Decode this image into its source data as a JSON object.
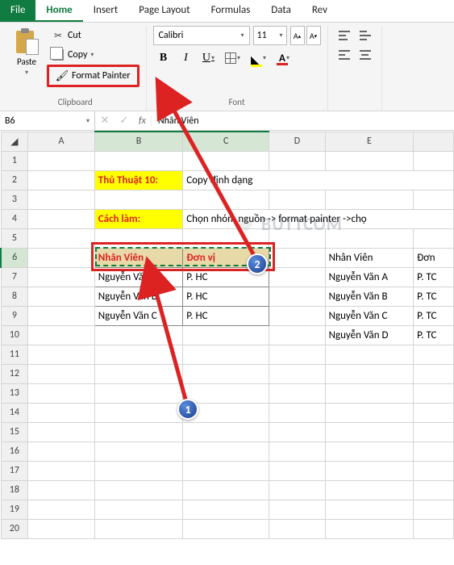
{
  "tabs": [
    "File",
    "Home",
    "Insert",
    "Page Layout",
    "Formulas",
    "Data",
    "Rev"
  ],
  "active_tab": 1,
  "clipboard": {
    "paste": "Paste",
    "cut": "Cut",
    "copy": "Copy",
    "format_painter": "Format Painter",
    "group_label": "Clipboard"
  },
  "font": {
    "name": "Calibri",
    "size": "11",
    "group_label": "Font"
  },
  "name_box": "B6",
  "formula_value": "Nhân Viên",
  "columns": [
    "A",
    "B",
    "C",
    "D",
    "E"
  ],
  "rows": [
    "1",
    "2",
    "3",
    "4",
    "5",
    "6",
    "7",
    "8",
    "9",
    "10",
    "11",
    "12",
    "13",
    "14",
    "15",
    "16",
    "17",
    "18",
    "19",
    "20"
  ],
  "cells": {
    "B2": "Thủ Thuật 10:",
    "C2": "Copy định dạng",
    "B4": "Cách làm:",
    "C4": "Chọn nhóm nguồn -> format painter ->chọ",
    "B6": "Nhân Viên",
    "C6": "Đơn vị",
    "B7": "Nguyễn Văn A",
    "C7": "P. HC",
    "B8": "Nguyễn Văn B",
    "C8": "P. HC",
    "B9": "Nguyễn Văn C",
    "C9": "P. HC",
    "E6": "Nhân Viên",
    "F6": "Đơn",
    "E7": "Nguyễn Văn A",
    "F7": "P. TC",
    "E8": "Nguyễn Văn B",
    "F8": "P. TC",
    "E9": "Nguyễn Văn C",
    "F9": "P. TC",
    "E10": "Nguyễn Văn D",
    "F10": "P. TC"
  },
  "badges": {
    "one": "1",
    "two": "2"
  },
  "watermark": "BUTTCOM"
}
